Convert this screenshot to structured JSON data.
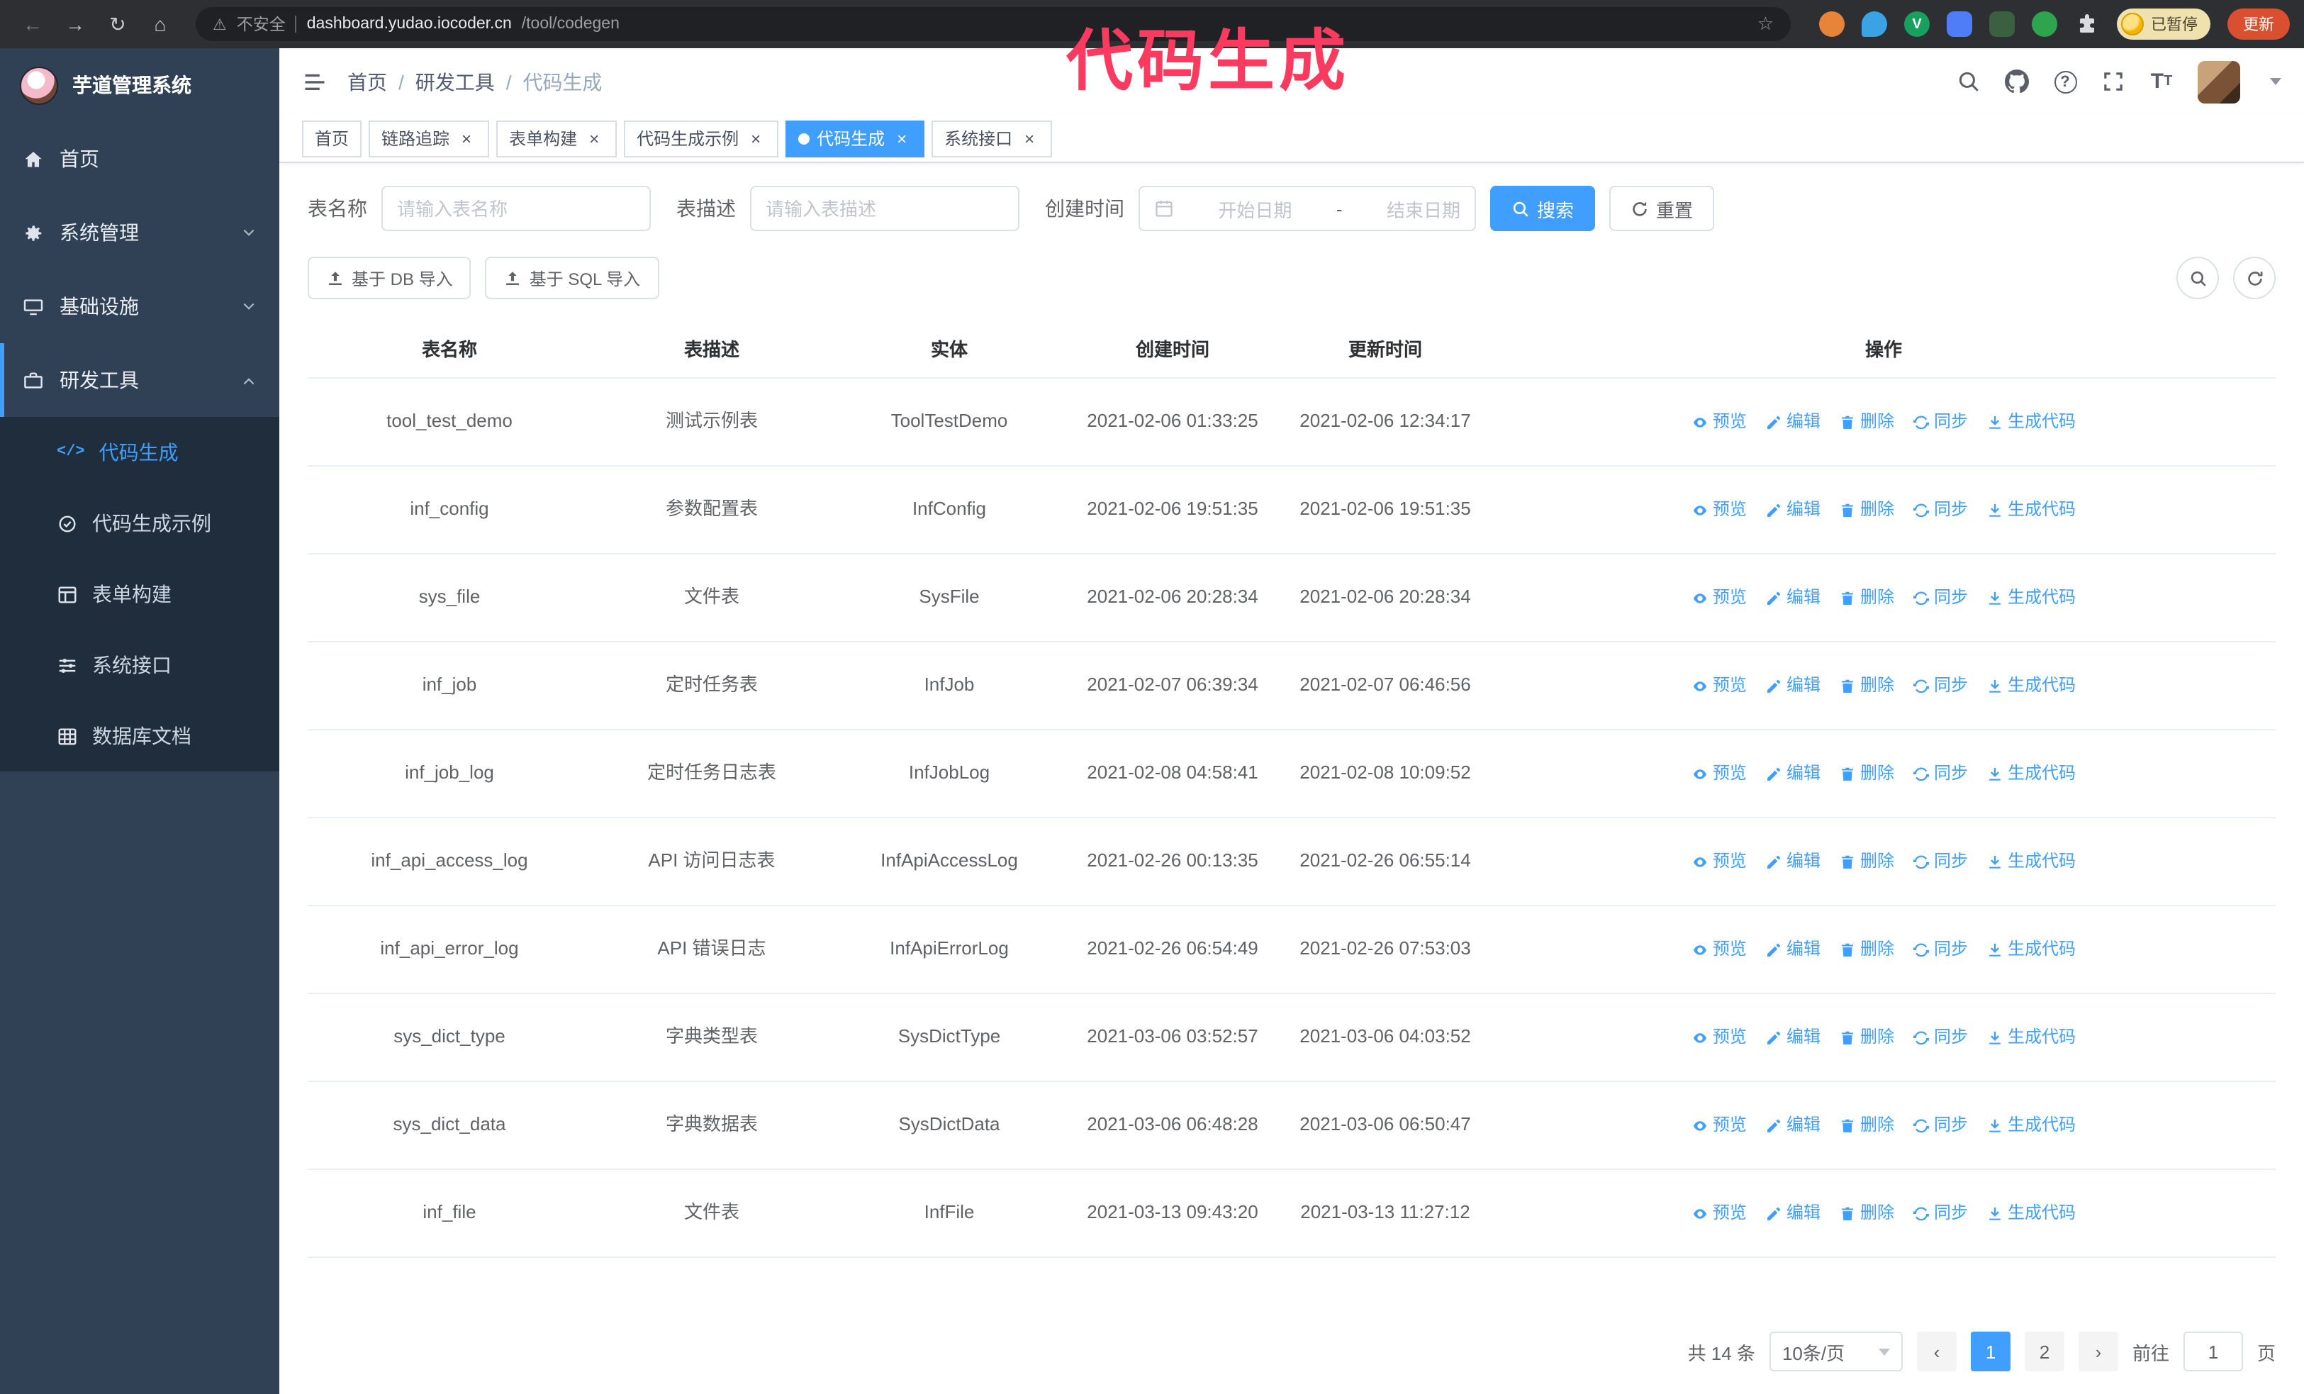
{
  "annotation": {
    "text": "代码生成"
  },
  "browser": {
    "security_label": "不安全",
    "url_host": "dashboard.yudao.iocoder.cn",
    "url_path": "/tool/codegen",
    "paused_badge": "已暂停",
    "update_button": "更新"
  },
  "glyphs": {
    "back": "←",
    "forward": "→",
    "reload": "↻",
    "home": "⌂",
    "warning": "⚠",
    "star": "☆",
    "close": "×",
    "breadcrumb_sep": "/",
    "prev": "‹",
    "next": "›",
    "code": "</>",
    "question": "?",
    "ext_v": "V",
    "tt_big": "T",
    "tt_small": "T",
    "date_sep": "-"
  },
  "sidebar": {
    "app_title": "芋道管理系统",
    "items": [
      {
        "label": "首页"
      },
      {
        "label": "系统管理"
      },
      {
        "label": "基础设施"
      },
      {
        "label": "研发工具"
      }
    ],
    "submenu": [
      {
        "label": "代码生成"
      },
      {
        "label": "代码生成示例"
      },
      {
        "label": "表单构建"
      },
      {
        "label": "系统接口"
      },
      {
        "label": "数据库文档"
      }
    ]
  },
  "breadcrumb": {
    "items": [
      "首页",
      "研发工具",
      "代码生成"
    ]
  },
  "tabs": [
    {
      "label": "首页",
      "closable": false,
      "active": false
    },
    {
      "label": "链路追踪",
      "closable": true,
      "active": false
    },
    {
      "label": "表单构建",
      "closable": true,
      "active": false
    },
    {
      "label": "代码生成示例",
      "closable": true,
      "active": false
    },
    {
      "label": "代码生成",
      "closable": true,
      "active": true
    },
    {
      "label": "系统接口",
      "closable": true,
      "active": false
    }
  ],
  "filters": {
    "table_name_label": "表名称",
    "table_name_placeholder": "请输入表名称",
    "table_desc_label": "表描述",
    "table_desc_placeholder": "请输入表描述",
    "create_time_label": "创建时间",
    "date_start_placeholder": "开始日期",
    "date_separator": "-",
    "date_end_placeholder": "结束日期",
    "search_button": "搜索",
    "reset_button": "重置"
  },
  "toolbar": {
    "import_db": "基于 DB 导入",
    "import_sql": "基于 SQL 导入"
  },
  "table": {
    "columns": [
      "表名称",
      "表描述",
      "实体",
      "创建时间",
      "更新时间",
      "操作"
    ],
    "actions": [
      "预览",
      "编辑",
      "删除",
      "同步",
      "生成代码"
    ],
    "rows": [
      {
        "name": "tool_test_demo",
        "desc": "测试示例表",
        "entity": "ToolTestDemo",
        "created": "2021-02-06 01:33:25",
        "updated": "2021-02-06 12:34:17"
      },
      {
        "name": "inf_config",
        "desc": "参数配置表",
        "entity": "InfConfig",
        "created": "2021-02-06 19:51:35",
        "updated": "2021-02-06 19:51:35"
      },
      {
        "name": "sys_file",
        "desc": "文件表",
        "entity": "SysFile",
        "created": "2021-02-06 20:28:34",
        "updated": "2021-02-06 20:28:34"
      },
      {
        "name": "inf_job",
        "desc": "定时任务表",
        "entity": "InfJob",
        "created": "2021-02-07 06:39:34",
        "updated": "2021-02-07 06:46:56"
      },
      {
        "name": "inf_job_log",
        "desc": "定时任务日志表",
        "entity": "InfJobLog",
        "created": "2021-02-08 04:58:41",
        "updated": "2021-02-08 10:09:52"
      },
      {
        "name": "inf_api_access_log",
        "desc": "API 访问日志表",
        "entity": "InfApiAccessLog",
        "created": "2021-02-26 00:13:35",
        "updated": "2021-02-26 06:55:14"
      },
      {
        "name": "inf_api_error_log",
        "desc": "API 错误日志",
        "entity": "InfApiErrorLog",
        "created": "2021-02-26 06:54:49",
        "updated": "2021-02-26 07:53:03"
      },
      {
        "name": "sys_dict_type",
        "desc": "字典类型表",
        "entity": "SysDictType",
        "created": "2021-03-06 03:52:57",
        "updated": "2021-03-06 04:03:52"
      },
      {
        "name": "sys_dict_data",
        "desc": "字典数据表",
        "entity": "SysDictData",
        "created": "2021-03-06 06:48:28",
        "updated": "2021-03-06 06:50:47"
      },
      {
        "name": "inf_file",
        "desc": "文件表",
        "entity": "InfFile",
        "created": "2021-03-13 09:43:20",
        "updated": "2021-03-13 11:27:12"
      }
    ]
  },
  "pagination": {
    "total": "共 14 条",
    "page_size": "10条/页",
    "page_1": "1",
    "page_2": "2",
    "goto_label": "前往",
    "goto_value": "1",
    "goto_suffix": "页"
  },
  "colors": {
    "primary": "#409EFF",
    "annotation": "#FB3A5F",
    "sidebar_bg": "#304156",
    "submenu_bg": "#1F2D3D",
    "update_button_bg": "#D94F30"
  }
}
